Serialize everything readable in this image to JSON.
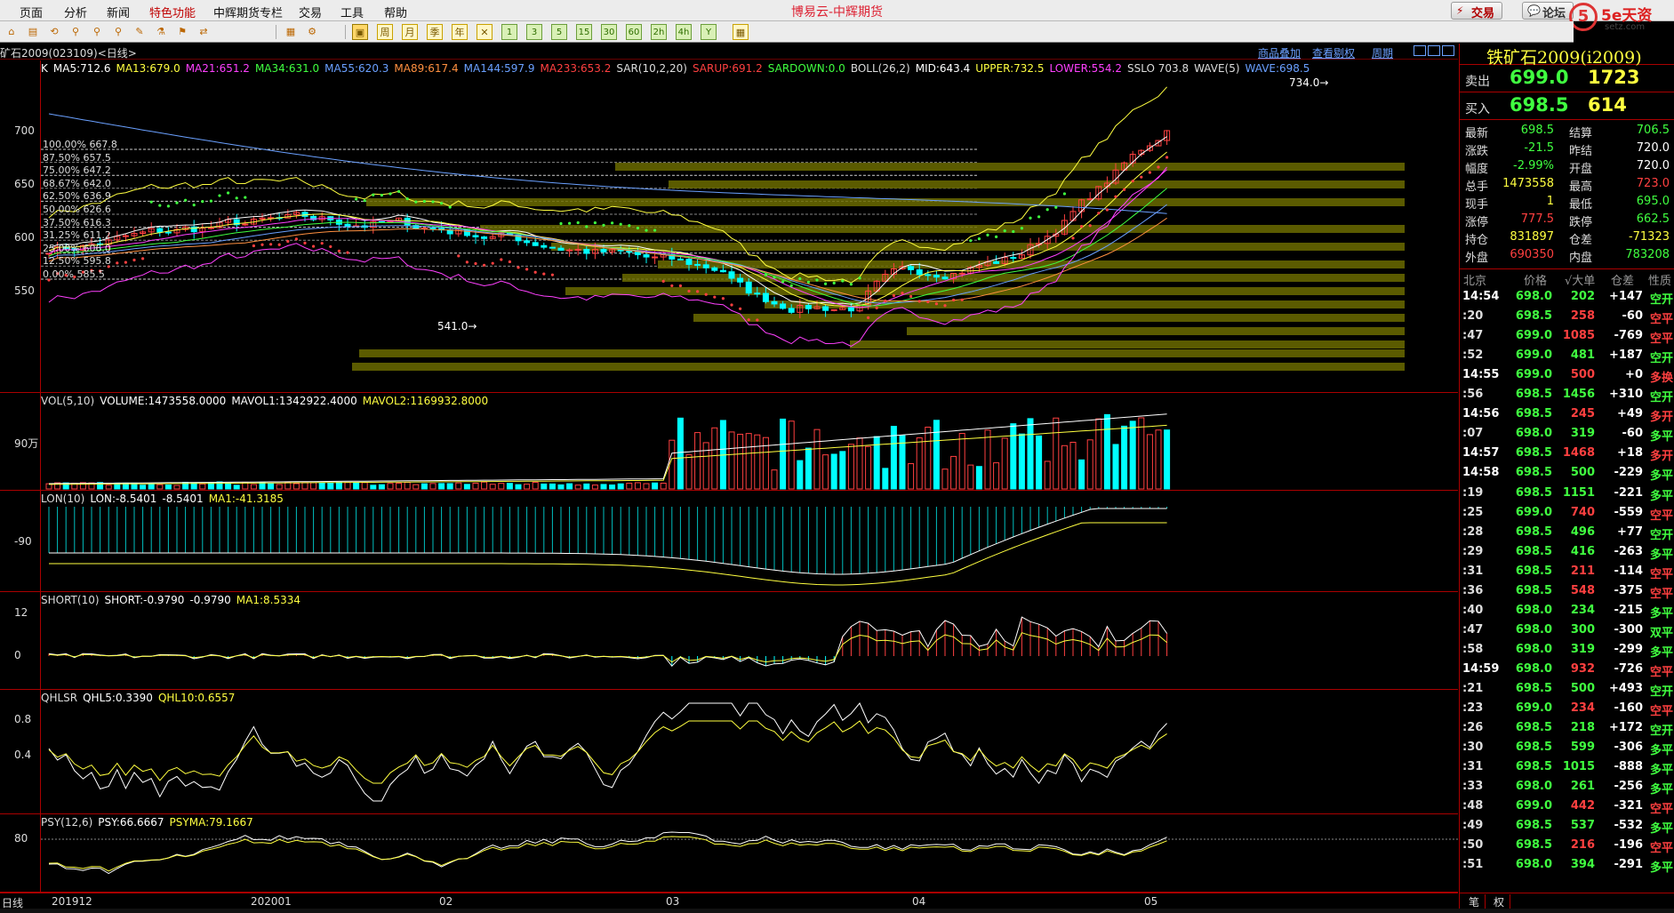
{
  "menu": {
    "items": [
      "页面",
      "分析",
      "新闻",
      "特色功能",
      "中辉期货专栏",
      "交易",
      "工具",
      "帮助"
    ],
    "special_index": 3
  },
  "app_title": "博易云-中辉期货",
  "top_buttons": {
    "trade": "交易",
    "forum": "论坛"
  },
  "logo": {
    "mark": "5",
    "brand": "5e天资",
    "url": "setz.com"
  },
  "toolbar": {
    "periods": [
      "周",
      "月",
      "季",
      "年"
    ],
    "minutes": [
      "1",
      "3",
      "5",
      "15",
      "30",
      "60",
      "2h",
      "4h",
      "Y"
    ]
  },
  "contract_label": "矿石2009(023109)<日线>",
  "info_links": [
    "商品叠加",
    "查看剔权",
    "周期"
  ],
  "colors": {
    "up": "#ff4040",
    "down": "#00ffff",
    "green": "#40ff40",
    "yellow": "#ffff40",
    "magenta": "#ff40ff",
    "white": "#ffffff",
    "grid": "#a00000"
  },
  "kline": {
    "legend": [
      {
        "text": "K",
        "color": "#ffffff"
      },
      {
        "text": "MA5:712.6",
        "color": "#ffffff"
      },
      {
        "text": "MA13:679.0",
        "color": "#ffff40"
      },
      {
        "text": "MA21:651.2",
        "color": "#ff40ff"
      },
      {
        "text": "MA34:631.0",
        "color": "#40ff40"
      },
      {
        "text": "MA55:620.3",
        "color": "#6aa0ff"
      },
      {
        "text": "MA89:617.4",
        "color": "#ff9040"
      },
      {
        "text": "MA144:597.9",
        "color": "#6aa0ff"
      },
      {
        "text": "MA233:653.2",
        "color": "#ff4040"
      },
      {
        "text": "SAR(10,2,20)",
        "color": "#dddddd"
      },
      {
        "text": "SARUP:691.2",
        "color": "#ff4040"
      },
      {
        "text": "SARDOWN:0.0",
        "color": "#40ff40"
      },
      {
        "text": "BOLL(26,2)",
        "color": "#dddddd"
      },
      {
        "text": "MID:643.4",
        "color": "#ffffff"
      },
      {
        "text": "UPPER:732.5",
        "color": "#ffff40"
      },
      {
        "text": "LOWER:554.2",
        "color": "#ff40ff"
      },
      {
        "text": "SSLO 703.8",
        "color": "#dddddd"
      },
      {
        "text": "WAVE(5)",
        "color": "#dddddd"
      },
      {
        "text": "WAVE:698.5",
        "color": "#6aa0ff"
      }
    ],
    "yticks": [
      "700",
      "650",
      "600",
      "550"
    ],
    "ytick_values": [
      700,
      650,
      600,
      550
    ],
    "fib_levels": [
      {
        "label": "100.00%",
        "price": "667.8"
      },
      {
        "label": "87.50%",
        "price": "657.5"
      },
      {
        "label": "75.00%",
        "price": "647.2"
      },
      {
        "label": "68.67%",
        "price": "642.0"
      },
      {
        "label": "62.50%",
        "price": "636.9"
      },
      {
        "label": "50.00%",
        "price": "626.6"
      },
      {
        "label": "37.50%",
        "price": "616.3"
      },
      {
        "label": "31.25%",
        "price": "611.2"
      },
      {
        "label": "25.00%",
        "price": "606.0"
      },
      {
        "label": "12.50%",
        "price": "595.8"
      },
      {
        "label": "0.00%",
        "price": "585.5"
      }
    ],
    "high_mark": "734.0",
    "low_mark": "541.0"
  },
  "volume": {
    "legend": [
      {
        "text": "VOL(5,10)",
        "color": "#dddddd"
      },
      {
        "text": "VOLUME:1473558.0000",
        "color": "#ffffff"
      },
      {
        "text": "MAVOL1:1342922.4000",
        "color": "#ffffff"
      },
      {
        "text": "MAVOL2:1169932.8000",
        "color": "#ffff40"
      }
    ],
    "yticks": [
      "90万"
    ]
  },
  "lon": {
    "legend": [
      {
        "text": "LON(10)",
        "color": "#dddddd"
      },
      {
        "text": "LON:-8.5401",
        "color": "#ffffff"
      },
      {
        "text": "-8.5401",
        "color": "#ffffff"
      },
      {
        "text": "MA1:-41.3185",
        "color": "#ffff40"
      }
    ],
    "yticks": [
      "-90"
    ]
  },
  "short": {
    "legend": [
      {
        "text": "SHORT(10)",
        "color": "#dddddd"
      },
      {
        "text": "SHORT:-0.9790",
        "color": "#ffffff"
      },
      {
        "text": "-0.9790",
        "color": "#ffffff"
      },
      {
        "text": "MA1:8.5334",
        "color": "#ffff40"
      }
    ],
    "yticks": [
      "12",
      "0"
    ]
  },
  "qhlsr": {
    "legend": [
      {
        "text": "QHLSR",
        "color": "#dddddd"
      },
      {
        "text": "QHL5:0.3390",
        "color": "#ffffff"
      },
      {
        "text": "QHL10:0.6557",
        "color": "#ffff40"
      }
    ],
    "yticks": [
      "0.8",
      "0.4"
    ]
  },
  "psy": {
    "legend": [
      {
        "text": "PSY(12,6)",
        "color": "#dddddd"
      },
      {
        "text": "PSY:66.6667",
        "color": "#ffffff"
      },
      {
        "text": "PSYMA:79.1667",
        "color": "#ffff40"
      }
    ],
    "yticks": [
      "80"
    ]
  },
  "date_axis": [
    "日线",
    "201912",
    "202001",
    "02",
    "03",
    "04",
    "05"
  ],
  "quote": {
    "title": "铁矿石2009(i2009)",
    "sell": {
      "label": "卖出",
      "price": "699.0",
      "vol": "1723"
    },
    "buy": {
      "label": "买入",
      "price": "698.5",
      "vol": "614"
    },
    "stats": [
      {
        "l1": "最新",
        "v1": "698.5",
        "c1": "#40ff40",
        "l2": "结算",
        "v2": "706.5",
        "c2": "#40ff40"
      },
      {
        "l1": "涨跌",
        "v1": "-21.5",
        "c1": "#40ff40",
        "l2": "昨结",
        "v2": "720.0",
        "c2": "#ffffff"
      },
      {
        "l1": "幅度",
        "v1": "-2.99%",
        "c1": "#40ff40",
        "l2": "开盘",
        "v2": "720.0",
        "c2": "#ffffff"
      },
      {
        "l1": "总手",
        "v1": "1473558",
        "c1": "#ffff40",
        "l2": "最高",
        "v2": "723.0",
        "c2": "#ff4040"
      },
      {
        "l1": "现手",
        "v1": "1",
        "c1": "#ffff40",
        "l2": "最低",
        "v2": "695.0",
        "c2": "#40ff40"
      },
      {
        "l1": "涨停",
        "v1": "777.5",
        "c1": "#ff4040",
        "l2": "跌停",
        "v2": "662.5",
        "c2": "#40ff40"
      },
      {
        "l1": "持仓",
        "v1": "831897",
        "c1": "#ffff40",
        "l2": "仓差",
        "v2": "-71323",
        "c2": "#ffff40"
      },
      {
        "l1": "外盘",
        "v1": "690350",
        "c1": "#ff4040",
        "l2": "内盘",
        "v2": "783208",
        "c2": "#40ff40"
      }
    ],
    "trade_header": [
      "北京",
      "价格",
      "√大单",
      "仓差",
      "性质"
    ],
    "trades": [
      {
        "t": "14:54",
        "full": true,
        "p": "698.0",
        "v": "202",
        "o": "+147",
        "n": "空开",
        "pc": "#40ff40",
        "vc": "#40ff40",
        "nc": "#40ff40"
      },
      {
        "t": ":20",
        "full": false,
        "p": "698.5",
        "v": "258",
        "o": "-60",
        "n": "空平",
        "pc": "#40ff40",
        "vc": "#ff4040",
        "nc": "#ff4040"
      },
      {
        "t": ":47",
        "full": false,
        "p": "699.0",
        "v": "1085",
        "o": "-769",
        "n": "空平",
        "pc": "#40ff40",
        "vc": "#ff4040",
        "nc": "#ff4040"
      },
      {
        "t": ":52",
        "full": false,
        "p": "699.0",
        "v": "481",
        "o": "+187",
        "n": "空开",
        "pc": "#40ff40",
        "vc": "#40ff40",
        "nc": "#40ff40"
      },
      {
        "t": "14:55",
        "full": true,
        "p": "699.0",
        "v": "500",
        "o": "+0",
        "n": "多换",
        "pc": "#40ff40",
        "vc": "#ff4040",
        "nc": "#ff4040"
      },
      {
        "t": ":56",
        "full": false,
        "p": "698.5",
        "v": "1456",
        "o": "+310",
        "n": "空开",
        "pc": "#40ff40",
        "vc": "#40ff40",
        "nc": "#40ff40"
      },
      {
        "t": "14:56",
        "full": true,
        "p": "698.5",
        "v": "245",
        "o": "+49",
        "n": "多开",
        "pc": "#40ff40",
        "vc": "#ff4040",
        "nc": "#ff4040"
      },
      {
        "t": ":07",
        "full": false,
        "p": "698.0",
        "v": "319",
        "o": "-60",
        "n": "多平",
        "pc": "#40ff40",
        "vc": "#40ff40",
        "nc": "#40ff40"
      },
      {
        "t": "14:57",
        "full": true,
        "p": "698.5",
        "v": "1468",
        "o": "+18",
        "n": "多开",
        "pc": "#40ff40",
        "vc": "#ff4040",
        "nc": "#ff4040"
      },
      {
        "t": "14:58",
        "full": true,
        "p": "698.5",
        "v": "500",
        "o": "-229",
        "n": "多平",
        "pc": "#40ff40",
        "vc": "#40ff40",
        "nc": "#40ff40"
      },
      {
        "t": ":19",
        "full": false,
        "p": "698.5",
        "v": "1151",
        "o": "-221",
        "n": "多平",
        "pc": "#40ff40",
        "vc": "#40ff40",
        "nc": "#40ff40"
      },
      {
        "t": ":25",
        "full": false,
        "p": "699.0",
        "v": "740",
        "o": "-559",
        "n": "空平",
        "pc": "#40ff40",
        "vc": "#ff4040",
        "nc": "#ff4040"
      },
      {
        "t": ":28",
        "full": false,
        "p": "698.5",
        "v": "496",
        "o": "+77",
        "n": "空开",
        "pc": "#40ff40",
        "vc": "#40ff40",
        "nc": "#40ff40"
      },
      {
        "t": ":29",
        "full": false,
        "p": "698.5",
        "v": "416",
        "o": "-263",
        "n": "多平",
        "pc": "#40ff40",
        "vc": "#40ff40",
        "nc": "#40ff40"
      },
      {
        "t": ":31",
        "full": false,
        "p": "698.5",
        "v": "211",
        "o": "-114",
        "n": "空平",
        "pc": "#40ff40",
        "vc": "#ff4040",
        "nc": "#ff4040"
      },
      {
        "t": ":36",
        "full": false,
        "p": "698.5",
        "v": "548",
        "o": "-375",
        "n": "空平",
        "pc": "#40ff40",
        "vc": "#ff4040",
        "nc": "#ff4040"
      },
      {
        "t": ":40",
        "full": false,
        "p": "698.0",
        "v": "234",
        "o": "-215",
        "n": "多平",
        "pc": "#40ff40",
        "vc": "#40ff40",
        "nc": "#40ff40"
      },
      {
        "t": ":47",
        "full": false,
        "p": "698.0",
        "v": "300",
        "o": "-300",
        "n": "双平",
        "pc": "#40ff40",
        "vc": "#40ff40",
        "nc": "#40ff40"
      },
      {
        "t": ":58",
        "full": false,
        "p": "698.0",
        "v": "319",
        "o": "-299",
        "n": "多平",
        "pc": "#40ff40",
        "vc": "#40ff40",
        "nc": "#40ff40"
      },
      {
        "t": "14:59",
        "full": true,
        "p": "698.0",
        "v": "932",
        "o": "-726",
        "n": "空平",
        "pc": "#40ff40",
        "vc": "#ff4040",
        "nc": "#ff4040"
      },
      {
        "t": ":21",
        "full": false,
        "p": "698.5",
        "v": "500",
        "o": "+493",
        "n": "空开",
        "pc": "#40ff40",
        "vc": "#40ff40",
        "nc": "#40ff40"
      },
      {
        "t": ":23",
        "full": false,
        "p": "699.0",
        "v": "234",
        "o": "-160",
        "n": "空平",
        "pc": "#40ff40",
        "vc": "#ff4040",
        "nc": "#ff4040"
      },
      {
        "t": ":26",
        "full": false,
        "p": "698.5",
        "v": "218",
        "o": "+172",
        "n": "空开",
        "pc": "#40ff40",
        "vc": "#40ff40",
        "nc": "#40ff40"
      },
      {
        "t": ":30",
        "full": false,
        "p": "698.5",
        "v": "599",
        "o": "-306",
        "n": "多平",
        "pc": "#40ff40",
        "vc": "#40ff40",
        "nc": "#40ff40"
      },
      {
        "t": ":31",
        "full": false,
        "p": "698.5",
        "v": "1015",
        "o": "-888",
        "n": "多平",
        "pc": "#40ff40",
        "vc": "#40ff40",
        "nc": "#40ff40"
      },
      {
        "t": ":33",
        "full": false,
        "p": "698.0",
        "v": "261",
        "o": "-256",
        "n": "多平",
        "pc": "#40ff40",
        "vc": "#40ff40",
        "nc": "#40ff40"
      },
      {
        "t": ":48",
        "full": false,
        "p": "699.0",
        "v": "442",
        "o": "-321",
        "n": "空平",
        "pc": "#40ff40",
        "vc": "#ff4040",
        "nc": "#ff4040"
      },
      {
        "t": ":49",
        "full": false,
        "p": "698.5",
        "v": "537",
        "o": "-532",
        "n": "多平",
        "pc": "#40ff40",
        "vc": "#40ff40",
        "nc": "#40ff40"
      },
      {
        "t": ":50",
        "full": false,
        "p": "698.5",
        "v": "216",
        "o": "-196",
        "n": "空平",
        "pc": "#40ff40",
        "vc": "#ff4040",
        "nc": "#ff4040"
      },
      {
        "t": ":51",
        "full": false,
        "p": "698.0",
        "v": "394",
        "o": "-291",
        "n": "多平",
        "pc": "#40ff40",
        "vc": "#40ff40",
        "nc": "#40ff40"
      }
    ],
    "tabs": [
      "笔",
      "权"
    ]
  }
}
